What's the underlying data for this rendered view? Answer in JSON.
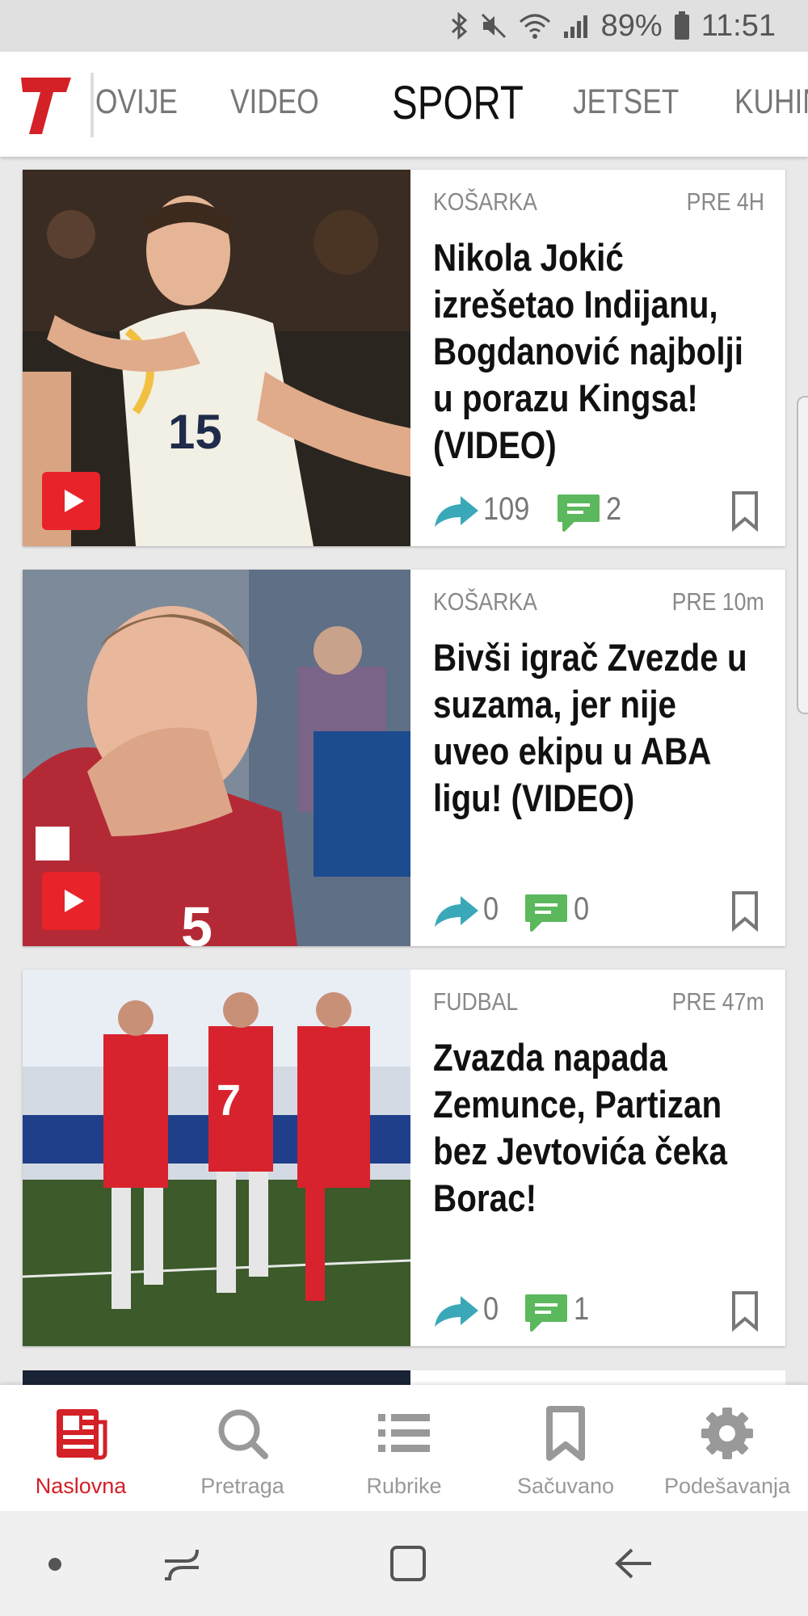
{
  "status": {
    "battery": "89%",
    "time": "11:51"
  },
  "header": {
    "tabs": [
      {
        "label": "OVIJE"
      },
      {
        "label": "VIDEO"
      },
      {
        "label": "SPORT"
      },
      {
        "label": "JETSET"
      },
      {
        "label": "KUHIN"
      }
    ],
    "active_tab": "SPORT"
  },
  "articles": [
    {
      "category": "KOŠARKA",
      "time": "PRE 4H",
      "title": "Nikola Jokić izrešetao Indijanu, Bogdanović najbolji u porazu Kingsa! (VIDEO)",
      "shares": "109",
      "comments": "2",
      "has_video": true
    },
    {
      "category": "KOŠARKA",
      "time": "PRE 10m",
      "title": "Bivši igrač Zvezde u suzama, jer nije uveo ekipu u ABA ligu! (VIDEO)",
      "shares": "0",
      "comments": "0",
      "has_video": true
    },
    {
      "category": "FUDBAL",
      "time": "PRE 47m",
      "title": "Zvazda napada Zemunce, Partizan bez Jevtovića čeka Borac!",
      "shares": "0",
      "comments": "1",
      "has_video": false
    }
  ],
  "bottom_nav": [
    {
      "label": "Naslovna",
      "icon": "newspaper-icon"
    },
    {
      "label": "Pretraga",
      "icon": "search-icon"
    },
    {
      "label": "Rubrike",
      "icon": "list-icon"
    },
    {
      "label": "Sačuvano",
      "icon": "bookmark-icon"
    },
    {
      "label": "Podešavanja",
      "icon": "gear-icon"
    }
  ],
  "colors": {
    "brand": "#d42027",
    "share": "#3aa8b8",
    "comment": "#5cb85c",
    "play": "#e8232a"
  }
}
